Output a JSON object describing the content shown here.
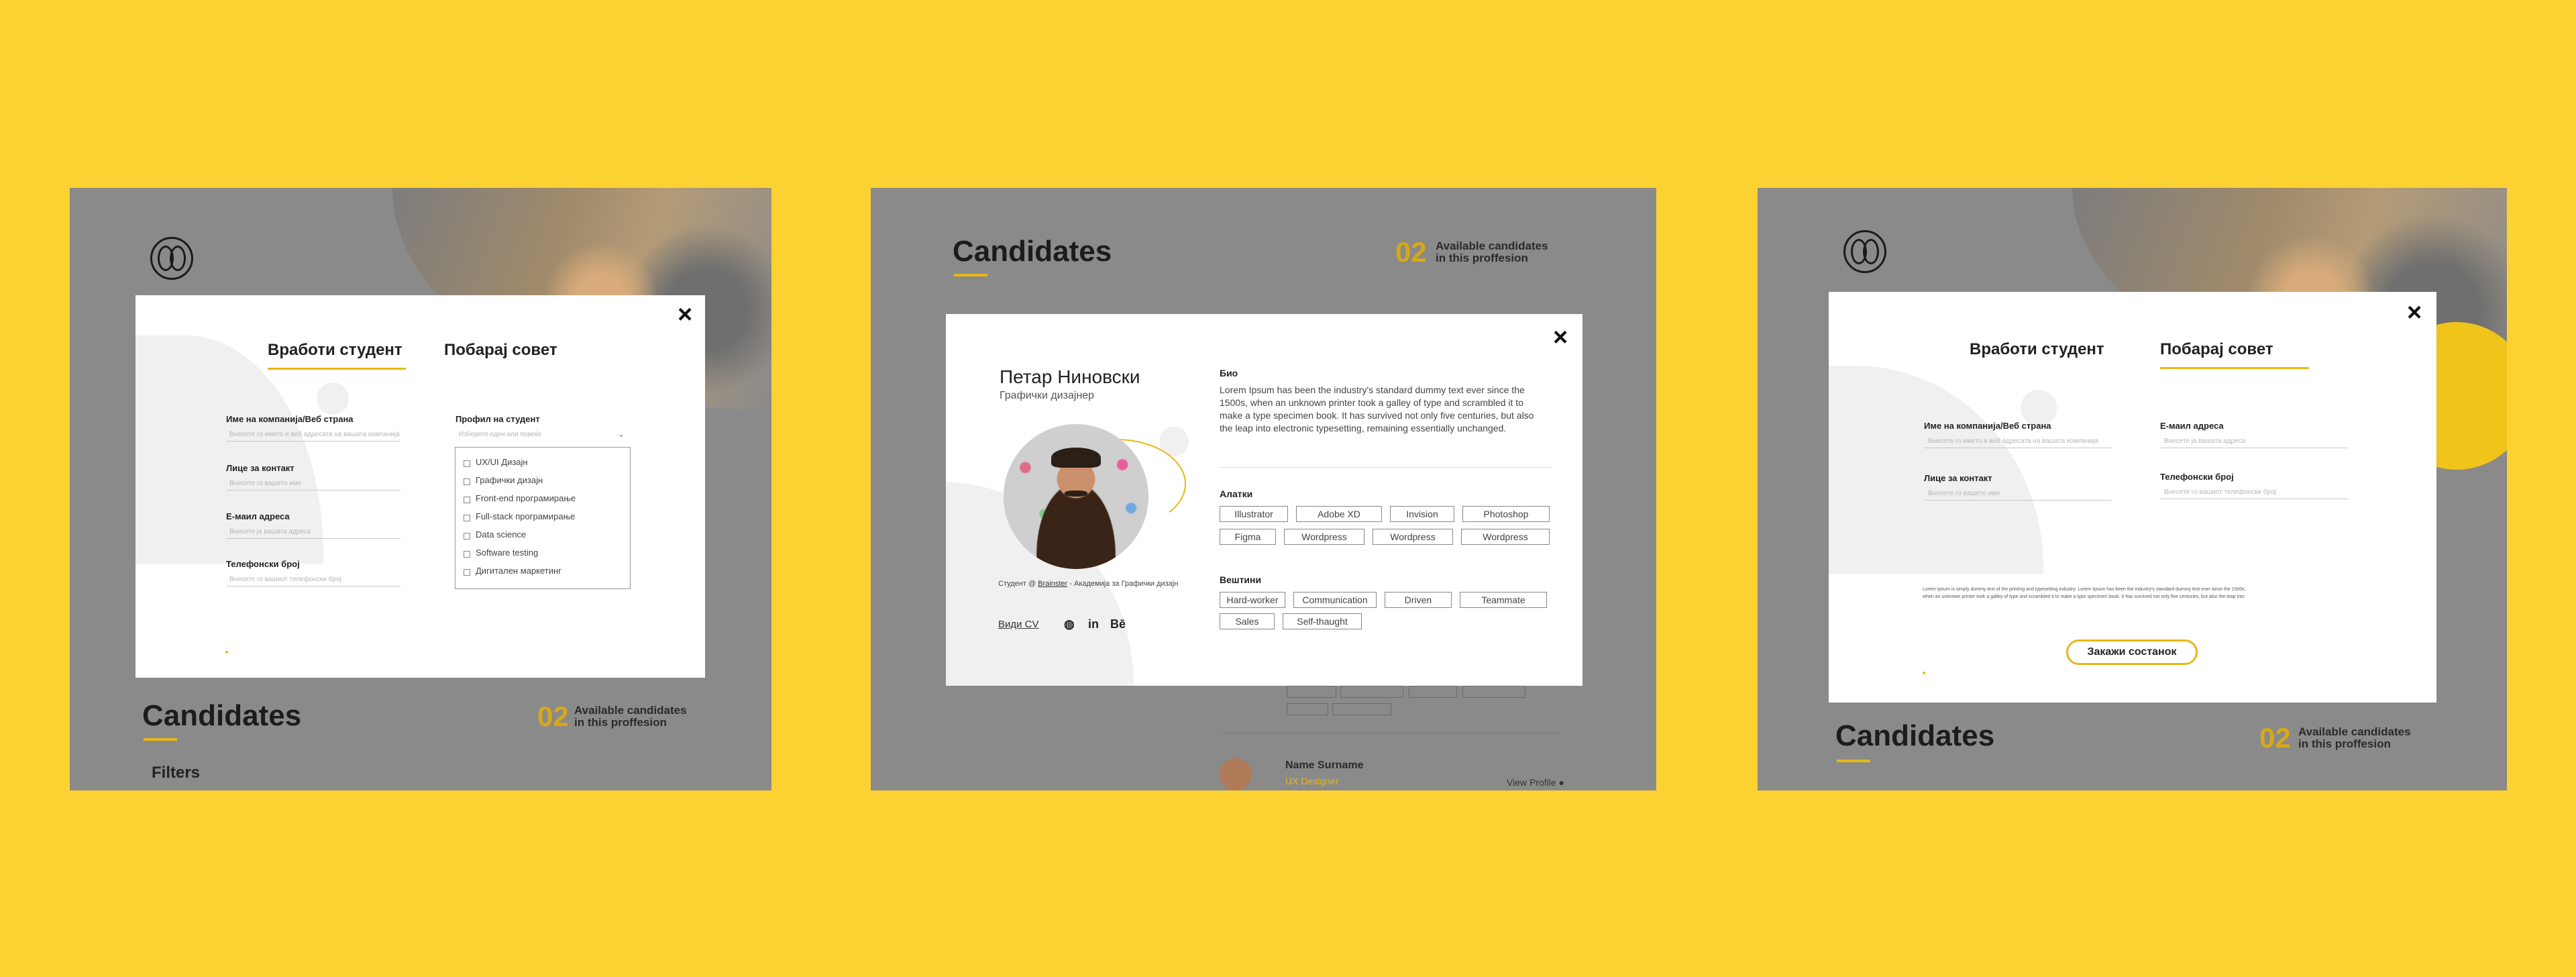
{
  "screen1": {
    "logo_icon": "brain-icon",
    "candidates_title": "Candidates",
    "count_num": "02",
    "count_line1": "Available candidates",
    "count_line2": "in this proffesion",
    "filters": "Filters",
    "modal": {
      "tab_hire": "Вработи студент",
      "tab_advice": "Побарај совет",
      "close": "×",
      "fields": [
        {
          "label": "Име на компанија/Веб страна",
          "placeholder": "Внесете го името и веб адресата на вашата компанија"
        },
        {
          "label": "Лице за контакт",
          "placeholder": "Внесете го вашето име"
        },
        {
          "label": "Е-маил адреса",
          "placeholder": "Внесете ја вашата адреса"
        },
        {
          "label": "Телефонски број",
          "placeholder": "Внесете го вашиот телефонски број"
        }
      ],
      "profile_label": "Профил на студент",
      "profile_placeholder": "Изберете еден или повеќе",
      "options": [
        "UX/UI Дизајн",
        "Графички дизајн",
        "Front-end програмирање",
        "Full-stack програмирање",
        "Data science",
        "Software testing",
        "Дигитален маркетинг"
      ]
    }
  },
  "screen2": {
    "candidates_title": "Candidates",
    "count_num": "02",
    "count_line1": "Available candidates",
    "count_line2": "in this proffesion",
    "bg_name": "Name Surname",
    "bg_role": "UX Designer",
    "bg_view": "View Profile ●",
    "modal": {
      "close": "×",
      "name": "Петар Ниновски",
      "role": "Графички дизајнер",
      "student_prefix": "Студент @ ",
      "student_link": "Brainster",
      "student_suffix": " - Академија за Графички дизајн",
      "cv": "Види CV",
      "social": [
        "globe-icon",
        "linkedin-icon",
        "behance-icon"
      ],
      "social_glyphs": [
        "◍",
        "in",
        "Bē"
      ],
      "bio_title": "Био",
      "bio_text": "Lorem Ipsum has been the industry's standard dummy text ever since the 1500s, when an unknown printer took a galley of type and scrambled it to make a type specimen book. It has survived not only five centuries, but also the leap into electronic typesetting, remaining essentially unchanged.",
      "tools_title": "Алатки",
      "tools": [
        "Illustrator",
        "Adobe XD",
        "Invision",
        "Photoshop",
        "Figma",
        "Wordpress",
        "Wordpress",
        "Wordpress"
      ],
      "skills_title": "Вештини",
      "skills": [
        "Hard-worker",
        "Communication",
        "Driven",
        "Teammate",
        "Sales",
        "Self-thaught"
      ]
    }
  },
  "screen3": {
    "logo_icon": "brain-icon",
    "candidates_title": "Candidates",
    "count_num": "02",
    "count_line1": "Available candidates",
    "count_line2": "in this proffesion",
    "modal": {
      "tab_hire": "Вработи студент",
      "tab_advice": "Побарај совет",
      "close": "×",
      "fields_left": [
        {
          "label": "Име на компанија/Веб страна",
          "placeholder": "Внесете го името и веб адресата на вашата компанија"
        },
        {
          "label": "Лице за контакт",
          "placeholder": "Внесете го вашето име"
        }
      ],
      "fields_right": [
        {
          "label": "Е-маил адреса",
          "placeholder": "Внесете ја вашата адреса"
        },
        {
          "label": "Телефонски број",
          "placeholder": "Внесете го вашиот телефонски број"
        }
      ],
      "lorem_line1": "Lorem Ipsum is simply dummy text of the printing and typesetting industry. Lorem Ipsum has been the industry's standard dummy text ever since the 1500s,",
      "lorem_line2": "when an unknown printer took a galley of type and scrambled it to make a type specimen book. It has survived not only five centuries, but also the leap into",
      "schedule_button": "Закажи состанок"
    }
  },
  "colors": {
    "background": "#fcd232",
    "accent": "#e7b816",
    "overlay": "#8a8a8a"
  }
}
